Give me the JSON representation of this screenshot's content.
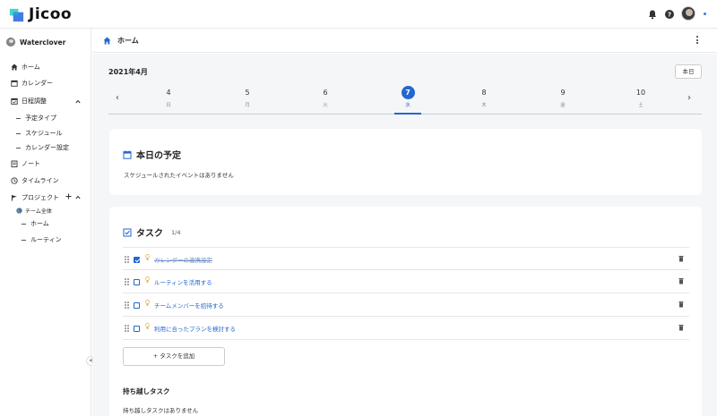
{
  "app": {
    "logo_text": "Jicoo"
  },
  "sidebar": {
    "user_name": "Waterclover",
    "items": [
      {
        "label": "ホーム"
      },
      {
        "label": "カレンダー"
      },
      {
        "label": "日程調整"
      },
      {
        "label": "予定タイプ"
      },
      {
        "label": "スケジュール"
      },
      {
        "label": "カレンダー設定"
      },
      {
        "label": "ノート"
      },
      {
        "label": "タイムライン"
      },
      {
        "label": "プロジェクト"
      },
      {
        "label": "チーム全体"
      },
      {
        "label": "ホーム"
      },
      {
        "label": "ルーティン"
      }
    ]
  },
  "header": {
    "title": "ホーム"
  },
  "calendar": {
    "month": "2021年4月",
    "today_label": "本日",
    "days": [
      {
        "num": "4",
        "dow": "日"
      },
      {
        "num": "5",
        "dow": "月"
      },
      {
        "num": "6",
        "dow": "火"
      },
      {
        "num": "7",
        "dow": "水"
      },
      {
        "num": "8",
        "dow": "木"
      },
      {
        "num": "9",
        "dow": "金"
      },
      {
        "num": "10",
        "dow": "土"
      }
    ],
    "prev": "‹",
    "next": "›"
  },
  "today_card": {
    "title": "本日の予定",
    "empty": "スケジュールされたイベントはありません"
  },
  "task_card": {
    "title": "タスク",
    "count": "1/4",
    "tasks": [
      {
        "text": "カレンダーの連携設定",
        "done": true
      },
      {
        "text": "ルーティンを活用する",
        "done": false
      },
      {
        "text": "チームメンバーを招待する",
        "done": false
      },
      {
        "text": "利用に合ったプランを検討する",
        "done": false
      }
    ],
    "add_label": "+ タスクを追加",
    "carry_title": "持ち越しタスク",
    "carry_empty": "持ち越しタスクはありません"
  },
  "colors": {
    "accent": "#2367d1"
  }
}
